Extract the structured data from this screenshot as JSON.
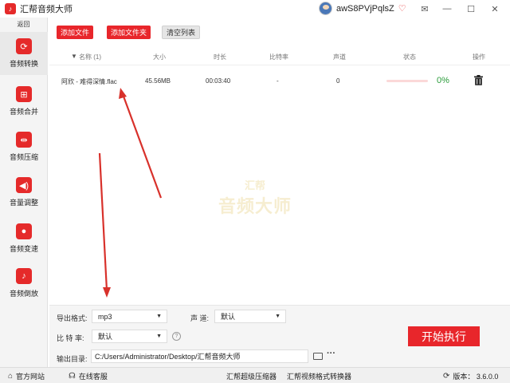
{
  "app": {
    "title": "汇帮音频大师",
    "logo_icon": "app-logo-icon",
    "user_name": "awS8PVjPqlsZ",
    "vip_icon": "heart-shield-icon",
    "window_controls": [
      "mail-icon",
      "minimize-icon",
      "maximize-icon",
      "close-icon"
    ]
  },
  "sidebar": {
    "back_label": "返回",
    "items": [
      {
        "label": "音频转换",
        "icon": "audio-convert-icon",
        "active": true
      },
      {
        "label": "音频合并",
        "icon": "audio-merge-icon",
        "active": false
      },
      {
        "label": "音频压缩",
        "icon": "audio-compress-icon",
        "active": false
      },
      {
        "label": "音量调整",
        "icon": "volume-icon",
        "active": false
      },
      {
        "label": "音频变速",
        "icon": "microphone-icon",
        "active": false
      },
      {
        "label": "音频倒放",
        "icon": "music-note-icon",
        "active": false
      }
    ]
  },
  "toolbar": {
    "add_file": "添加文件",
    "add_folder": "添加文件夹",
    "clear_list": "清空列表"
  },
  "table": {
    "columns": {
      "name": "名称 (1)",
      "size": "大小",
      "duration": "时长",
      "bitrate": "比特率",
      "channels": "声道",
      "status": "状态",
      "actions": "操作"
    },
    "rows": [
      {
        "name": "阿欣 - 难得深情.flac",
        "size": "45.56MB",
        "duration": "00:03:40",
        "bitrate": "-",
        "channels": "0",
        "progress": 0,
        "progress_label": "0%"
      }
    ]
  },
  "watermark": {
    "line1": "汇帮",
    "line2": "音频大师"
  },
  "settings": {
    "format_label": "导出格式:",
    "format_value": "mp3",
    "channel_label": "声 道:",
    "channel_value": "默认",
    "bitrate_label": "比 特 率:",
    "bitrate_value": "默认",
    "output_label": "输出目录:",
    "output_path": "C:/Users/Administrator/Desktop/汇帮音频大师",
    "start_button": "开始执行"
  },
  "footer": {
    "official_site": "官方网站",
    "support": "在线客服",
    "link1": "汇帮超级压缩器",
    "link2": "汇帮视频格式转换器",
    "version": "版本： 3.6.0.0"
  },
  "colors": {
    "accent": "#e8262b",
    "success": "#2a9c3a"
  }
}
